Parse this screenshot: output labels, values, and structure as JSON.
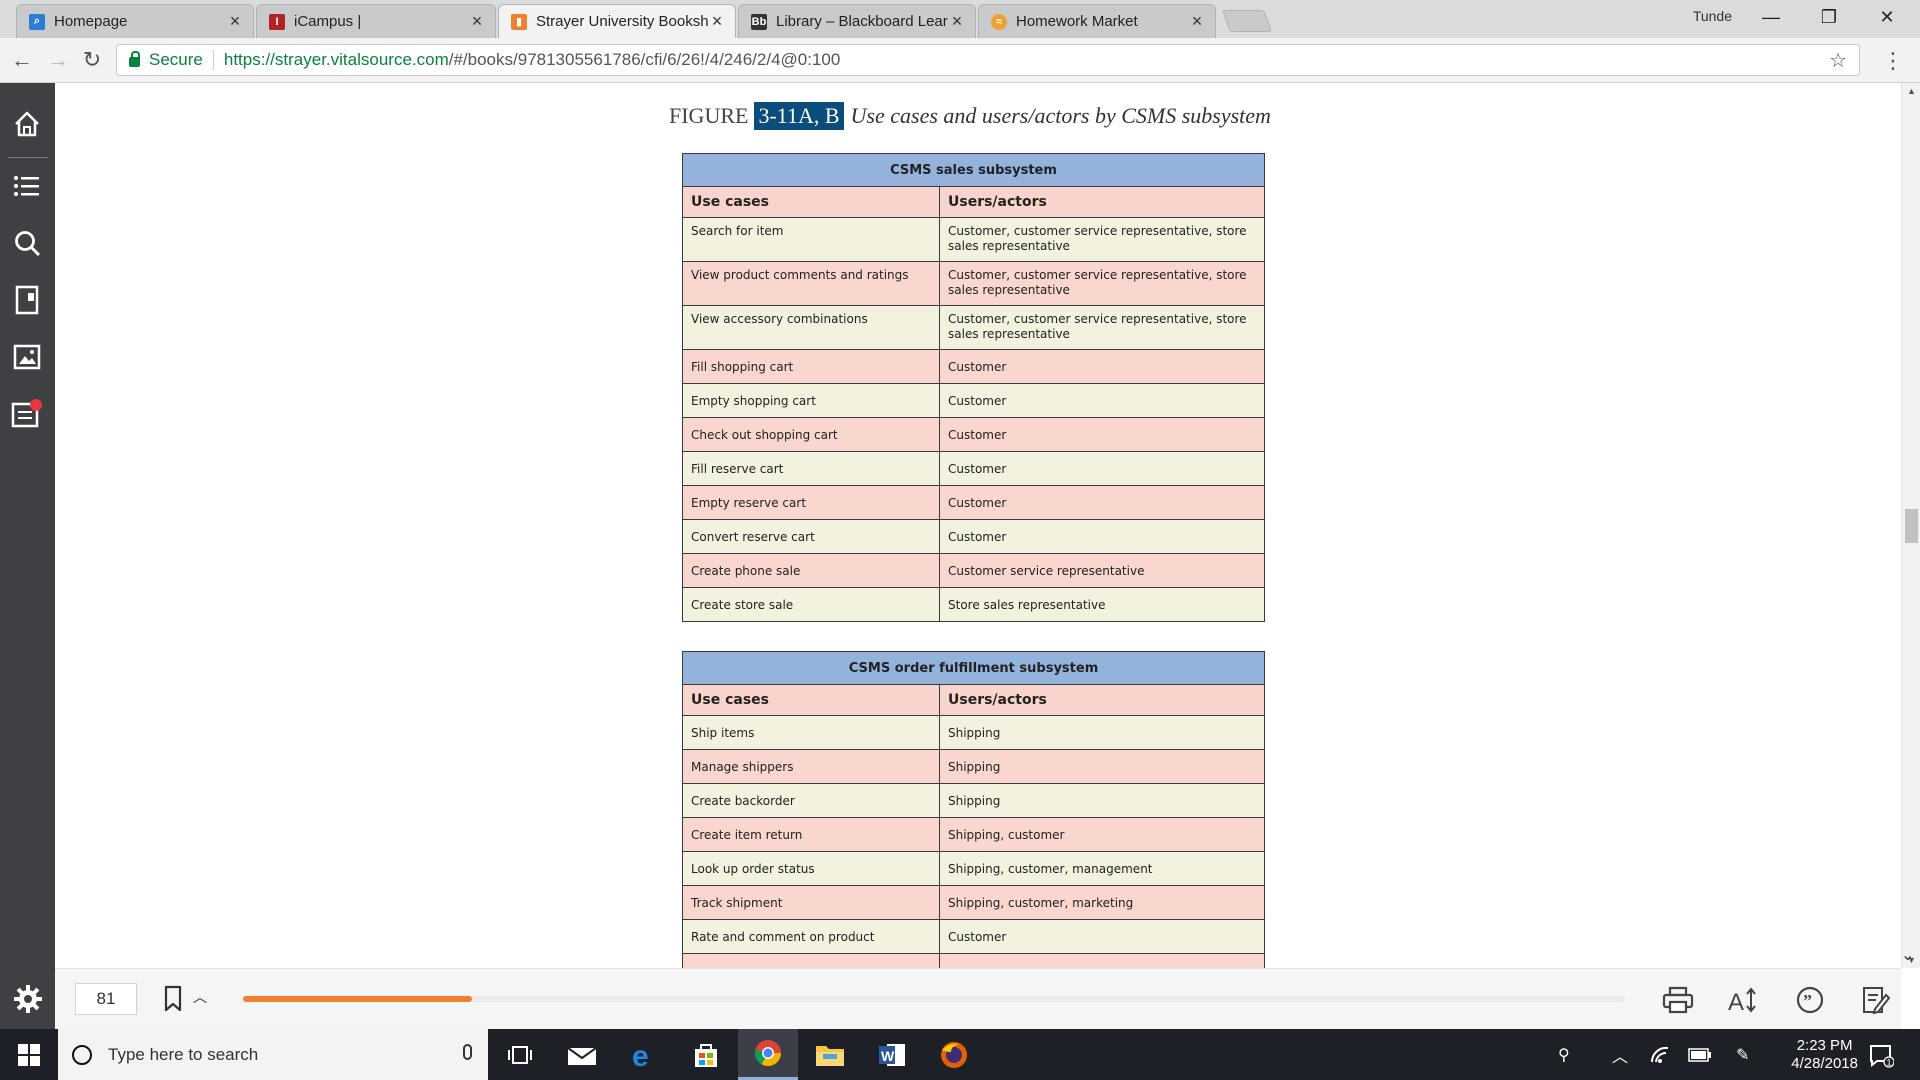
{
  "browser": {
    "tabs": [
      {
        "title": "Homepage",
        "favicon_color": "#2b7cd3",
        "active": false
      },
      {
        "title": "iCampus |",
        "favicon_color": "#b22222",
        "active": false
      },
      {
        "title": "Strayer University Booksh",
        "favicon_color": "#f08030",
        "active": true
      },
      {
        "title": "Library – Blackboard Lear",
        "favicon_color": "#333333",
        "active": false
      },
      {
        "title": "Homework Market",
        "favicon_color": "#f0a030",
        "active": false
      }
    ],
    "user_name": "Tunde",
    "address": {
      "secure_label": "Secure",
      "url_host": "https://strayer.vitalsource.com",
      "url_path": "/#/books/9781305561786/cfi/6/26!/4/246/2/4@0:100"
    }
  },
  "figure": {
    "label": "FIGURE",
    "number": "3-11A, B",
    "caption": "Use cases and users/actors by CSMS subsystem"
  },
  "tables": [
    {
      "title": "CSMS sales subsystem",
      "col_headers": [
        "Use cases",
        "Users/actors"
      ],
      "rows": [
        {
          "use_case": "Search for item",
          "actors": "Customer, customer service representative, store sales representative"
        },
        {
          "use_case": "View product comments and ratings",
          "actors": "Customer, customer service representative, store sales representative"
        },
        {
          "use_case": "View accessory combinations",
          "actors": "Customer, customer service representative, store sales representative"
        },
        {
          "use_case": "Fill shopping cart",
          "actors": "Customer"
        },
        {
          "use_case": "Empty shopping cart",
          "actors": "Customer"
        },
        {
          "use_case": "Check out shopping cart",
          "actors": "Customer"
        },
        {
          "use_case": "Fill reserve cart",
          "actors": "Customer"
        },
        {
          "use_case": "Empty reserve cart",
          "actors": "Customer"
        },
        {
          "use_case": "Convert reserve cart",
          "actors": "Customer"
        },
        {
          "use_case": "Create phone sale",
          "actors": "Customer service representative"
        },
        {
          "use_case": "Create store sale",
          "actors": "Store sales representative"
        }
      ]
    },
    {
      "title": "CSMS order fulfillment subsystem",
      "col_headers": [
        "Use cases",
        "Users/actors"
      ],
      "rows": [
        {
          "use_case": "Ship items",
          "actors": "Shipping"
        },
        {
          "use_case": "Manage shippers",
          "actors": "Shipping"
        },
        {
          "use_case": "Create backorder",
          "actors": "Shipping"
        },
        {
          "use_case": "Create item return",
          "actors": "Shipping, customer"
        },
        {
          "use_case": "Look up order status",
          "actors": "Shipping, customer, management"
        },
        {
          "use_case": "Track shipment",
          "actors": "Shipping, customer, marketing"
        },
        {
          "use_case": "Rate and comment on product",
          "actors": "Customer"
        },
        {
          "use_case": "",
          "actors": ""
        }
      ]
    }
  ],
  "reader": {
    "page_number": "81",
    "progress_fraction": 0.166
  },
  "taskbar": {
    "search_placeholder": "Type here to search",
    "time": "2:23 PM",
    "date": "4/28/2018",
    "notification_count": "1"
  }
}
